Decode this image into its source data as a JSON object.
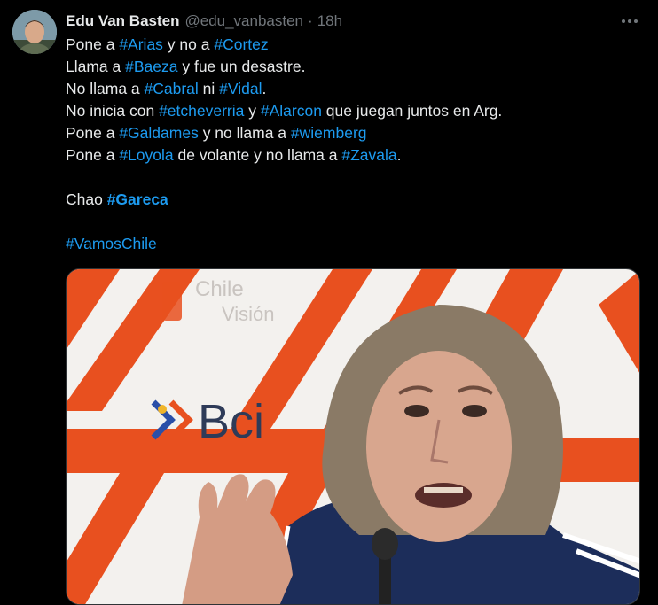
{
  "author": {
    "name": "Edu Van Basten",
    "handle": "@edu_vanbasten",
    "separator": "·",
    "time": "18h"
  },
  "lines": [
    [
      "Pone a ",
      "#Arias",
      " y no a ",
      "#Cortez"
    ],
    [
      "Llama a ",
      "#Baeza",
      " y fue un desastre."
    ],
    [
      "No llama a ",
      "#Cabral",
      " ni ",
      "#Vidal",
      "."
    ],
    [
      "No inicia con ",
      "#etcheverria",
      " y ",
      "#Alarcon",
      " que juegan juntos en Arg."
    ],
    [
      "Pone a ",
      "#Galdames",
      " y no llama a ",
      "#wiemberg"
    ],
    [
      "Pone a ",
      "#Loyola",
      " de volante y no llama a ",
      "#Zavala",
      "."
    ]
  ],
  "closing": {
    "text": "Chao ",
    "tag": "#Gareca"
  },
  "footer_tag": "#VamosChile",
  "media": {
    "backdrop_texts": [
      "Chile",
      "Visión",
      "Bci"
    ],
    "colors": {
      "orange": "#e8501f",
      "white": "#f3f1ee",
      "jacket": "#1c2d5a"
    }
  },
  "colors": {
    "link": "#1d9bf0",
    "text": "#e7e9ea",
    "muted": "#71767b",
    "background": "#000000"
  }
}
